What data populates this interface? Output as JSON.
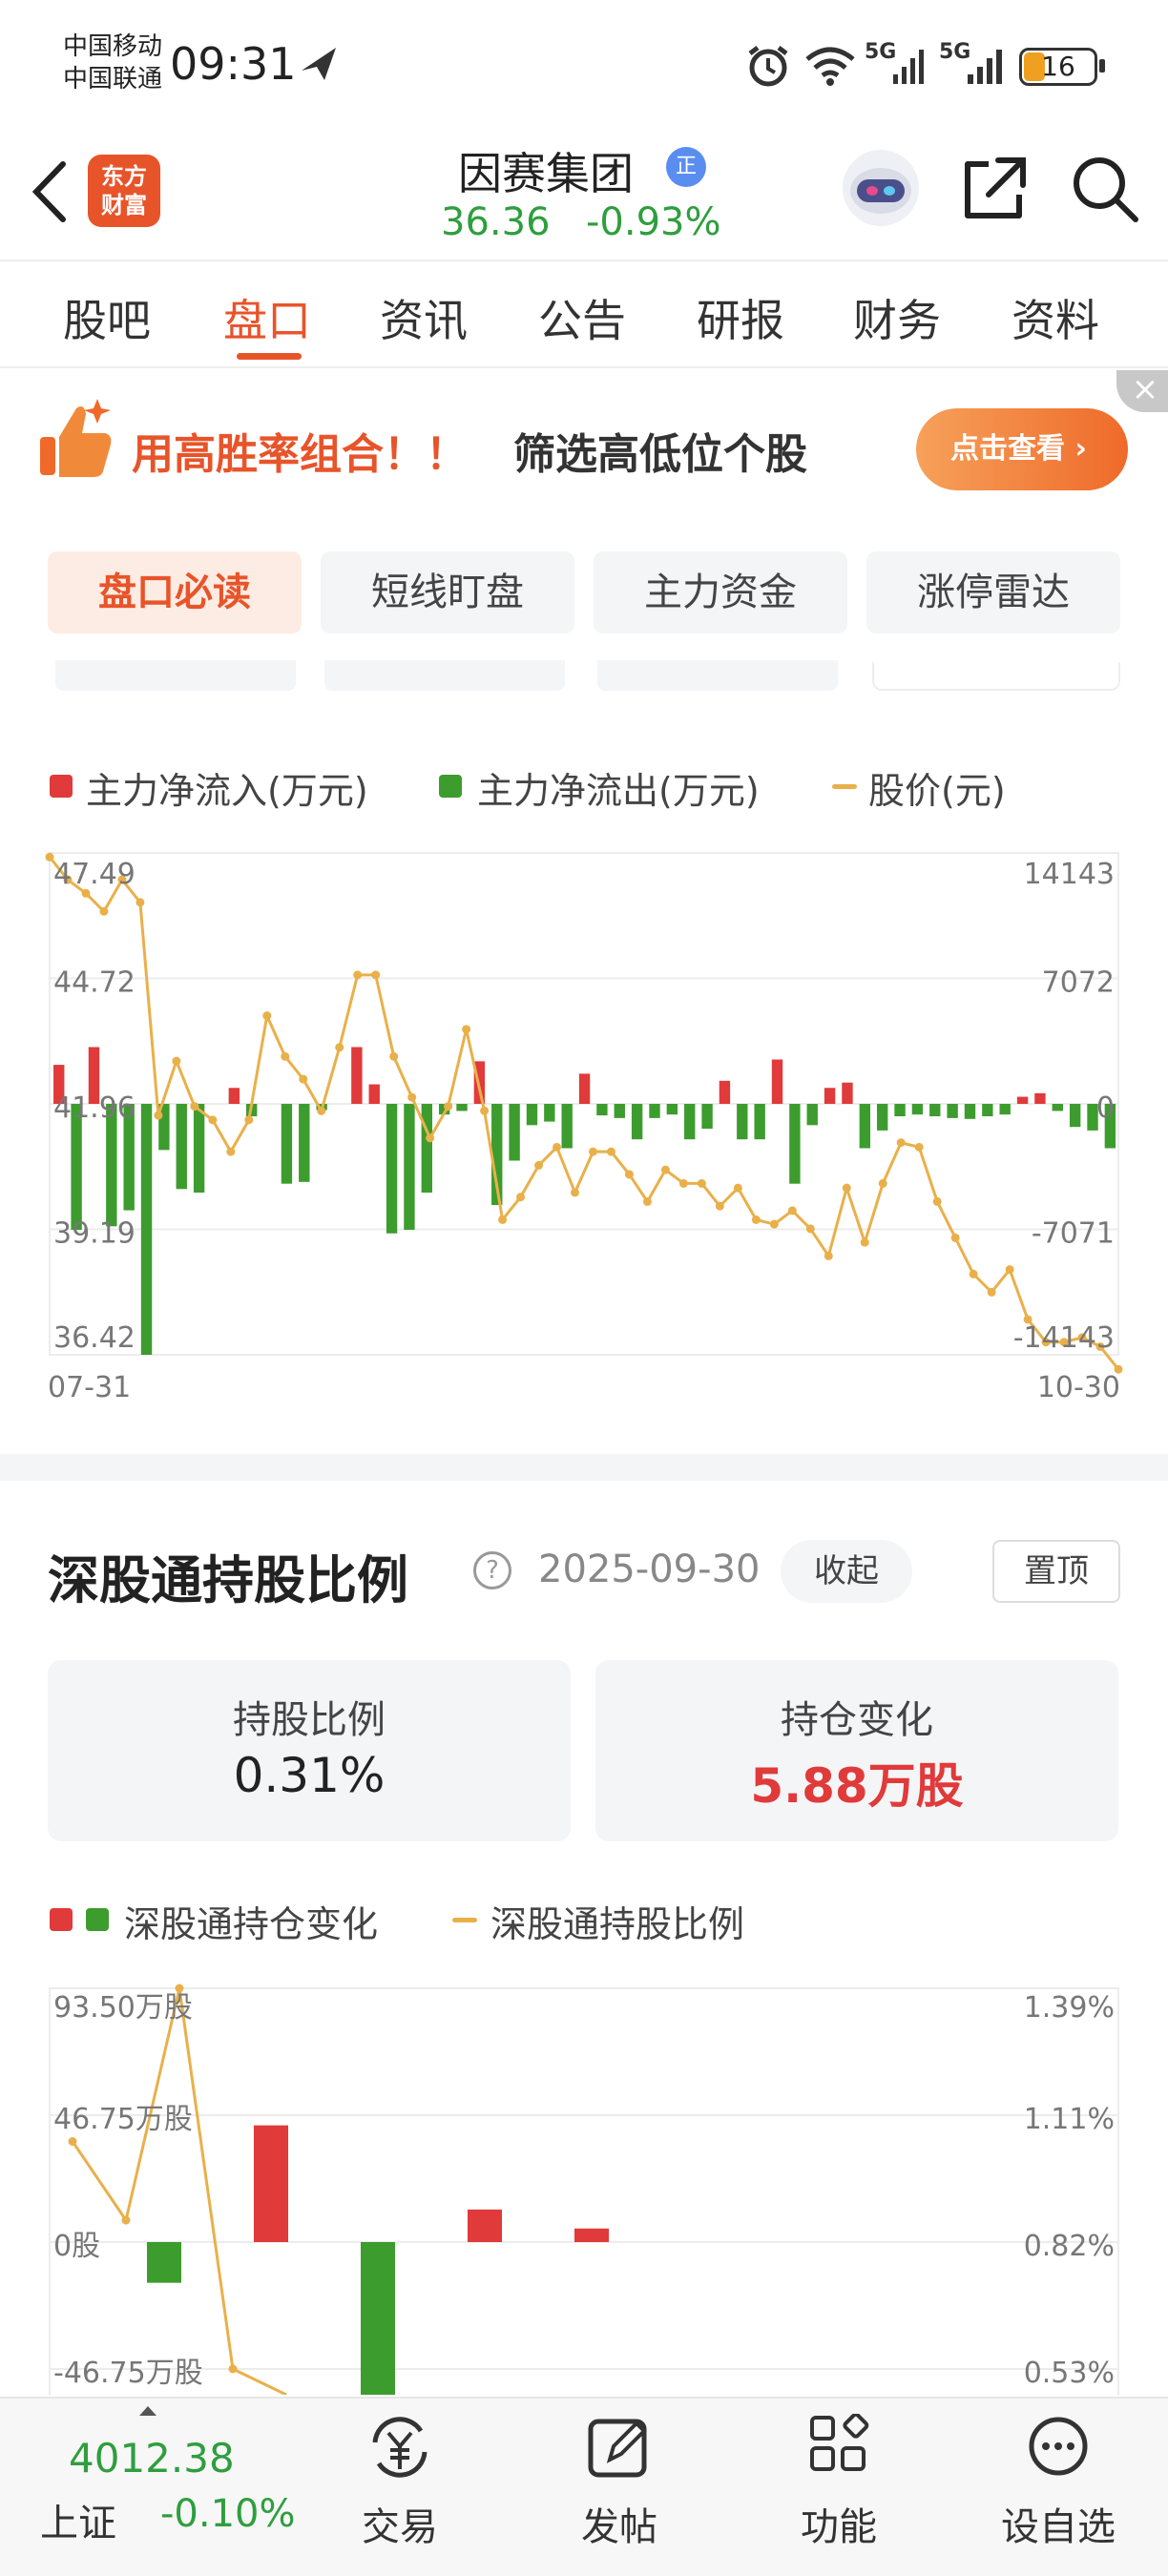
{
  "status_bar": {
    "carrier1": "中国移动",
    "carrier2": "中国联通",
    "time": "09:31",
    "signal1": "5G",
    "signal2": "5G",
    "battery": "16"
  },
  "header": {
    "app_logo_line1": "东方",
    "app_logo_line2": "财富",
    "stock_name": "因赛集团",
    "stock_badge": "正",
    "price": "36.36",
    "change_pct": "-0.93%"
  },
  "tabs": [
    "股吧",
    "盘口",
    "资讯",
    "公告",
    "研报",
    "财务",
    "资料"
  ],
  "active_tab": "盘口",
  "banner": {
    "text_highlight": "用高胜率组合！！",
    "text_rest": "筛选高低位个股",
    "button": "点击查看 ›",
    "close": "×"
  },
  "sub_tabs": [
    "盘口必读",
    "短线盯盘",
    "主力资金",
    "涨停雷达"
  ],
  "colors": {
    "up": "#e03a3a",
    "down": "#3d9c2e",
    "price_line": "#e9b04a",
    "accent": "#e8542a"
  },
  "chart_data": [
    {
      "type": "bar",
      "legend": [
        "主力净流入(万元)",
        "主力净流出(万元)",
        "股价(元)"
      ],
      "left_ticks": [
        "47.49",
        "44.72",
        "41.96",
        "39.19",
        "36.42"
      ],
      "right_ticks": [
        "14143",
        "7072",
        "0",
        "-7071",
        "-14143"
      ],
      "x_start": "07-31",
      "x_end": "10-30",
      "ylim_left": [
        36.42,
        47.49
      ],
      "ylim_right": [
        -14143,
        14143
      ],
      "flow_values": [
        2200,
        -7100,
        3200,
        -6900,
        -6000,
        -14143,
        -2600,
        -4800,
        -5000,
        0,
        900,
        -700,
        0,
        -4500,
        -4400,
        -350,
        0,
        3200,
        1100,
        -7300,
        -7100,
        -5000,
        -600,
        -400,
        2400,
        -5700,
        -3200,
        -1200,
        -1000,
        -2500,
        1700,
        -650,
        -800,
        -2000,
        -800,
        -600,
        -2000,
        -1400,
        1300,
        -2000,
        -2000,
        2500,
        -4500,
        -1200,
        900,
        1200,
        -2500,
        -1500,
        -700,
        -600,
        -700,
        -800,
        -850,
        -700,
        -600,
        400,
        600,
        -400,
        -1300,
        -1500,
        -2500
      ],
      "price_values": [
        47.4,
        46.9,
        46.6,
        46.2,
        46.9,
        46.4,
        41.7,
        42.9,
        41.9,
        41.6,
        40.9,
        41.6,
        43.9,
        43.0,
        42.5,
        41.8,
        43.2,
        44.8,
        44.8,
        43.0,
        42.1,
        41.2,
        41.9,
        43.6,
        41.8,
        39.4,
        39.9,
        40.6,
        41.0,
        40.0,
        40.9,
        40.9,
        40.4,
        39.8,
        40.5,
        40.2,
        40.2,
        39.7,
        40.1,
        39.4,
        39.3,
        39.6,
        39.2,
        38.6,
        40.1,
        38.9,
        40.2,
        41.1,
        41.0,
        39.8,
        39.0,
        38.2,
        37.8,
        38.3,
        37.2,
        36.7,
        36.7,
        36.8,
        36.6,
        36.1
      ]
    },
    {
      "type": "bar",
      "legend": [
        "深股通持仓变化",
        "深股通持股比例"
      ],
      "left_ticks": [
        "93.50万股",
        "46.75万股",
        "0股",
        "-46.75万股"
      ],
      "right_ticks": [
        "1.39%",
        "1.11%",
        "0.82%",
        "0.53%"
      ],
      "ylim_left": [
        -93.5,
        93.5
      ],
      "ylim_right": [
        0.25,
        1.39
      ],
      "holding_change": [
        0,
        -15,
        0,
        43,
        0,
        -60,
        0,
        12,
        0,
        5
      ],
      "holding_ratio": [
        1.05,
        0.87,
        1.39,
        0.53,
        0.2
      ]
    }
  ],
  "hk_section": {
    "title": "深股通持股比例",
    "help": "?",
    "date": "2025-09-30",
    "collapse_button": "收起",
    "pin_button": "置顶",
    "stats": [
      {
        "label": "持股比例",
        "value": "0.31%"
      },
      {
        "label": "持仓变化",
        "value": "5.88万股"
      }
    ]
  },
  "bottom_bar": {
    "index_value": "4012.38",
    "index_name": "上证",
    "index_change": "-0.10%",
    "items": [
      {
        "label": "交易",
        "icon": "yen-exchange-icon"
      },
      {
        "label": "发帖",
        "icon": "edit-icon"
      },
      {
        "label": "功能",
        "icon": "grid-icon"
      },
      {
        "label": "设自选",
        "icon": "more-dots-icon"
      }
    ]
  }
}
